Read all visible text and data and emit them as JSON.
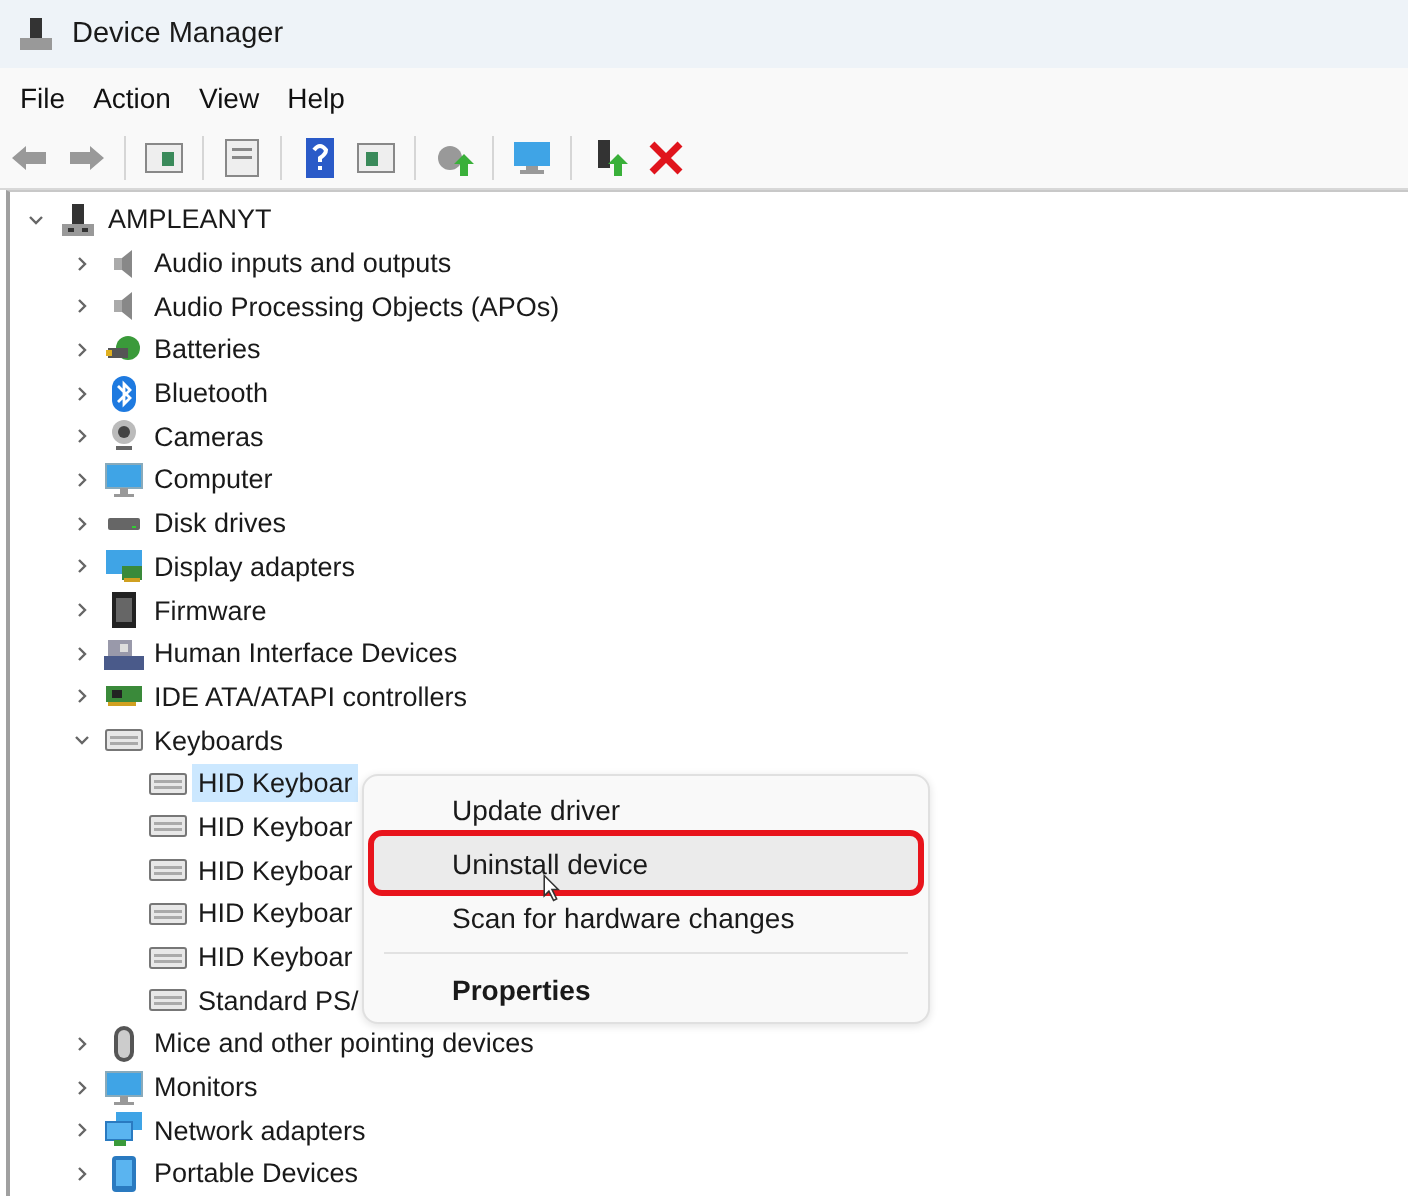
{
  "window": {
    "title": "Device Manager"
  },
  "menu_bar": [
    {
      "label": "File"
    },
    {
      "label": "Action"
    },
    {
      "label": "View"
    },
    {
      "label": "Help"
    }
  ],
  "tree": {
    "label": "AMPLEANYT",
    "kind": "computer",
    "expanded": true,
    "selected": false,
    "children": [
      {
        "label": "Audio inputs and outputs",
        "kind": "audio",
        "expanded": false,
        "selected": false
      },
      {
        "label": "Audio Processing Objects (APOs)",
        "kind": "audio",
        "expanded": false,
        "selected": false
      },
      {
        "label": "Batteries",
        "kind": "battery",
        "expanded": false,
        "selected": false
      },
      {
        "label": "Bluetooth",
        "kind": "bluetooth",
        "expanded": false,
        "selected": false
      },
      {
        "label": "Cameras",
        "kind": "camera",
        "expanded": false,
        "selected": false
      },
      {
        "label": "Computer",
        "kind": "monitor",
        "expanded": false,
        "selected": false
      },
      {
        "label": "Disk drives",
        "kind": "disk",
        "expanded": false,
        "selected": false
      },
      {
        "label": "Display adapters",
        "kind": "display",
        "expanded": false,
        "selected": false
      },
      {
        "label": "Firmware",
        "kind": "firmware",
        "expanded": false,
        "selected": false
      },
      {
        "label": "Human Interface Devices",
        "kind": "hid",
        "expanded": false,
        "selected": false
      },
      {
        "label": "IDE ATA/ATAPI controllers",
        "kind": "card",
        "expanded": false,
        "selected": false
      },
      {
        "label": "Keyboards",
        "kind": "keyboard",
        "expanded": true,
        "selected": false,
        "children": [
          {
            "label": "HID Keyboar",
            "kind": "keyboard",
            "selected": true
          },
          {
            "label": "HID Keyboar",
            "kind": "keyboard",
            "selected": false
          },
          {
            "label": "HID Keyboar",
            "kind": "keyboard",
            "selected": false
          },
          {
            "label": "HID Keyboar",
            "kind": "keyboard",
            "selected": false
          },
          {
            "label": "HID Keyboar",
            "kind": "keyboard",
            "selected": false
          },
          {
            "label": "Standard PS/",
            "kind": "keyboard",
            "selected": false
          }
        ]
      },
      {
        "label": "Mice and other pointing devices",
        "kind": "mouse",
        "expanded": false,
        "selected": false
      },
      {
        "label": "Monitors",
        "kind": "monitor",
        "expanded": false,
        "selected": false
      },
      {
        "label": "Network adapters",
        "kind": "network",
        "expanded": false,
        "selected": false
      },
      {
        "label": "Portable Devices",
        "kind": "portable",
        "expanded": false,
        "selected": false
      }
    ]
  },
  "context_menu": {
    "items": [
      {
        "kind": "item",
        "label": "Update driver",
        "hovered": false,
        "outlined": false,
        "bold": false
      },
      {
        "kind": "item",
        "label": "Uninstall device",
        "hovered": true,
        "outlined": true,
        "bold": false
      },
      {
        "kind": "item",
        "label": "Scan for hardware changes",
        "hovered": false,
        "outlined": false,
        "bold": false
      },
      {
        "kind": "separator"
      },
      {
        "kind": "item",
        "label": "Properties",
        "hovered": false,
        "outlined": false,
        "bold": true
      }
    ]
  }
}
